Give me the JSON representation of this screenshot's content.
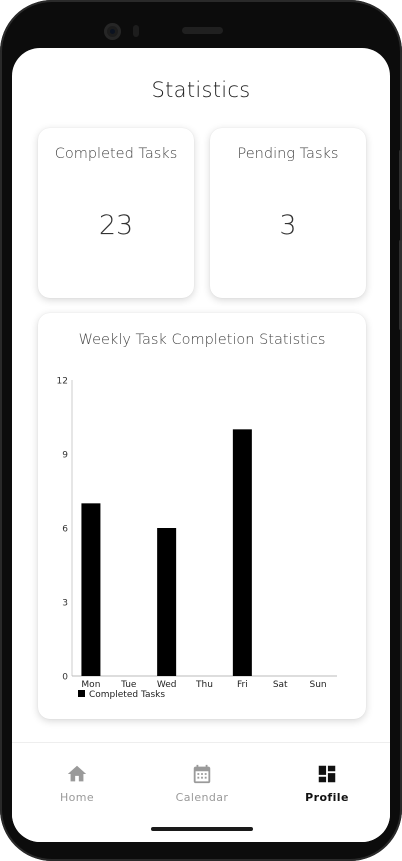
{
  "header": {
    "title": "Statistics"
  },
  "stats": [
    {
      "label": "Completed Tasks",
      "value": "23"
    },
    {
      "label": "Pending Tasks",
      "value": "3"
    }
  ],
  "chart_data": {
    "type": "bar",
    "title": "Weekly Task Completion Statistics",
    "categories": [
      "Mon",
      "Tue",
      "Wed",
      "Thu",
      "Fri",
      "Sat",
      "Sun"
    ],
    "series": [
      {
        "name": "Completed Tasks",
        "values": [
          7,
          0,
          6,
          0,
          10,
          0,
          0
        ]
      }
    ],
    "ylim": [
      0,
      12
    ],
    "yticks": [
      0,
      3,
      6,
      9,
      12
    ],
    "legend": "bottom-left",
    "grid": false,
    "bar_color": "#000000"
  },
  "nav": {
    "items": [
      {
        "label": "Home",
        "icon": "home-icon",
        "active": false
      },
      {
        "label": "Calendar",
        "icon": "calendar-icon",
        "active": false
      },
      {
        "label": "Profile",
        "icon": "dashboard-icon",
        "active": true
      }
    ]
  },
  "colors": {
    "active": "#111111",
    "inactive": "#9a9a9a"
  }
}
